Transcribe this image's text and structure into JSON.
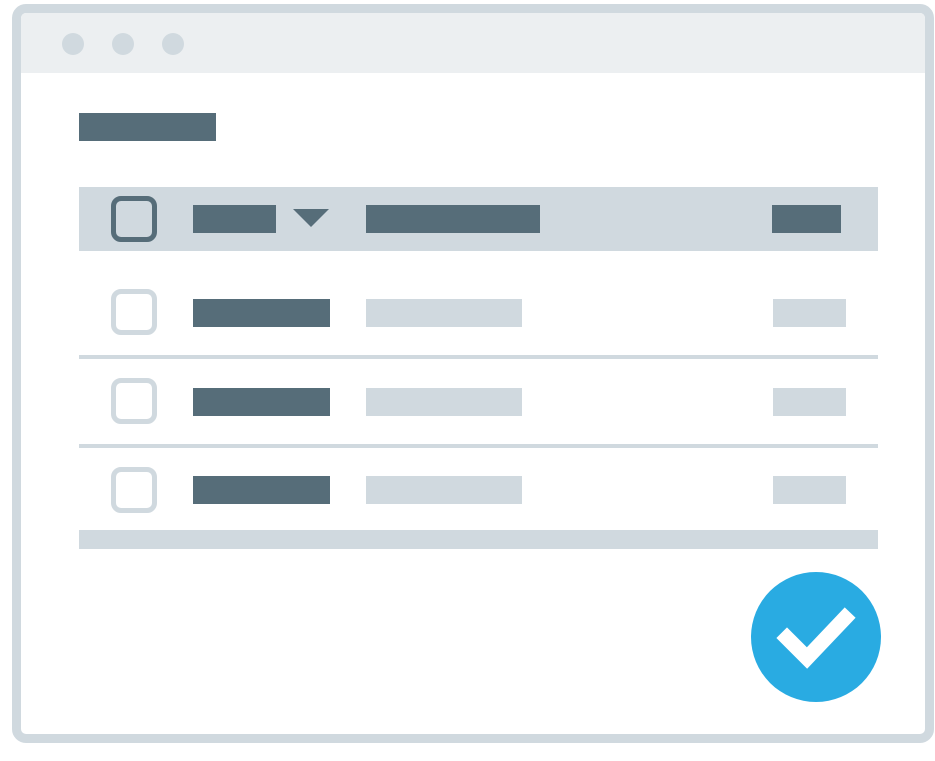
{
  "window": {
    "traffic_lights": [
      "window-dot",
      "window-dot",
      "window-dot"
    ]
  },
  "table": {
    "header": {
      "select_all_checked": false,
      "sort_direction": "descending"
    },
    "rows": [
      {
        "checked": false
      },
      {
        "checked": false
      },
      {
        "checked": false
      }
    ]
  },
  "confirm": {
    "icon": "check-icon"
  },
  "colors": {
    "frame": "#d0d9df",
    "titlebar": "#eceff1",
    "dark_placeholder": "#566d79",
    "light_placeholder": "#d0d9df",
    "accent": "#29abe2"
  }
}
